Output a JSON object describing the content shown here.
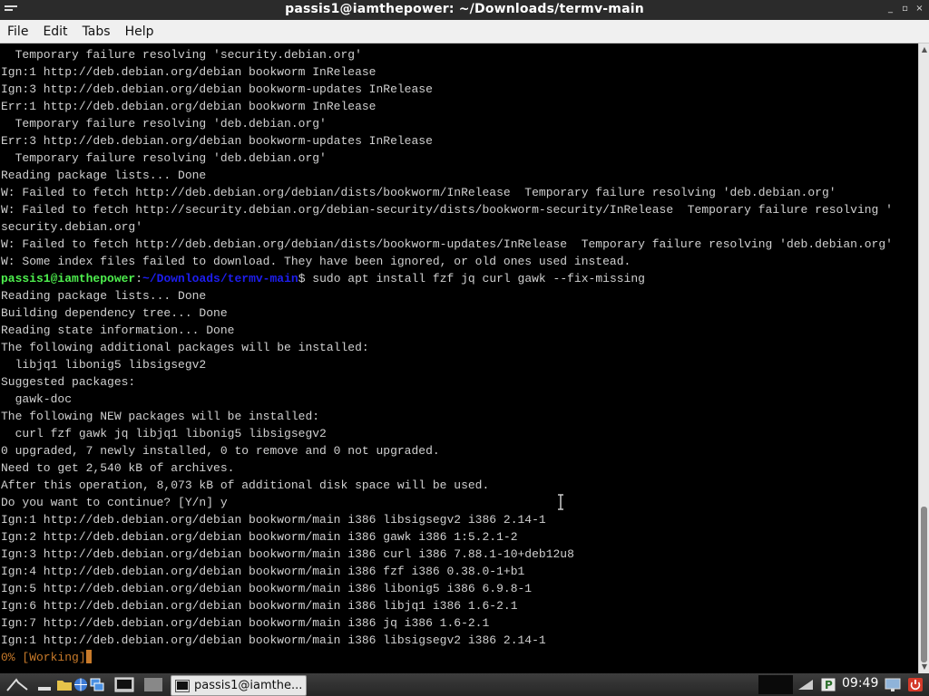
{
  "window": {
    "title": "passis1@iamthepower: ~/Downloads/termv-main",
    "controls": [
      "_",
      "▫",
      "×"
    ]
  },
  "menu": [
    "File",
    "Edit",
    "Tabs",
    "Help"
  ],
  "terminal": {
    "lines": [
      "  Temporary failure resolving 'security.debian.org'",
      "Ign:1 http://deb.debian.org/debian bookworm InRelease",
      "Ign:3 http://deb.debian.org/debian bookworm-updates InRelease",
      "Err:1 http://deb.debian.org/debian bookworm InRelease",
      "  Temporary failure resolving 'deb.debian.org'",
      "Err:3 http://deb.debian.org/debian bookworm-updates InRelease",
      "  Temporary failure resolving 'deb.debian.org'",
      "Reading package lists... Done",
      "W: Failed to fetch http://deb.debian.org/debian/dists/bookworm/InRelease  Temporary failure resolving 'deb.debian.org'",
      "W: Failed to fetch http://security.debian.org/debian-security/dists/bookworm-security/InRelease  Temporary failure resolving '",
      "security.debian.org'",
      "W: Failed to fetch http://deb.debian.org/debian/dists/bookworm-updates/InRelease  Temporary failure resolving 'deb.debian.org'",
      "W: Some index files failed to download. They have been ignored, or old ones used instead."
    ],
    "prompt": {
      "user": "passis1@iamthepower",
      "sep": ":",
      "path": "~/Downloads/termv-main",
      "cmd": "$ sudo apt install fzf jq curl gawk --fix-missing"
    },
    "lines2": [
      "Reading package lists... Done",
      "Building dependency tree... Done",
      "Reading state information... Done",
      "The following additional packages will be installed:",
      "  libjq1 libonig5 libsigsegv2",
      "Suggested packages:",
      "  gawk-doc",
      "The following NEW packages will be installed:",
      "  curl fzf gawk jq libjq1 libonig5 libsigsegv2",
      "0 upgraded, 7 newly installed, 0 to remove and 0 not upgraded.",
      "Need to get 2,540 kB of archives.",
      "After this operation, 8,073 kB of additional disk space will be used.",
      "Do you want to continue? [Y/n] y",
      "Ign:1 http://deb.debian.org/debian bookworm/main i386 libsigsegv2 i386 2.14-1",
      "Ign:2 http://deb.debian.org/debian bookworm/main i386 gawk i386 1:5.2.1-2",
      "Ign:3 http://deb.debian.org/debian bookworm/main i386 curl i386 7.88.1-10+deb12u8",
      "Ign:4 http://deb.debian.org/debian bookworm/main i386 fzf i386 0.38.0-1+b1",
      "Ign:5 http://deb.debian.org/debian bookworm/main i386 libonig5 i386 6.9.8-1",
      "Ign:6 http://deb.debian.org/debian bookworm/main i386 libjq1 i386 1.6-2.1",
      "Ign:7 http://deb.debian.org/debian bookworm/main i386 jq i386 1.6-2.1",
      "Ign:1 http://deb.debian.org/debian bookworm/main i386 libsigsegv2 i386 2.14-1"
    ],
    "progress_text": "0% [Working]"
  },
  "taskbar": {
    "task_label": "passis1@iamthe...",
    "clock": "09:49",
    "icons": [
      "menu-icon",
      "show-desktop-icon",
      "file-manager-icon",
      "browser-icon",
      "workspace-icon",
      "terminal-icon",
      "app-grid-icon"
    ]
  },
  "colors": {
    "prompt_user": "#4ef04e",
    "prompt_path": "#1e1ef0",
    "progress": "#c87a2a",
    "text": "#d0d0d0"
  }
}
